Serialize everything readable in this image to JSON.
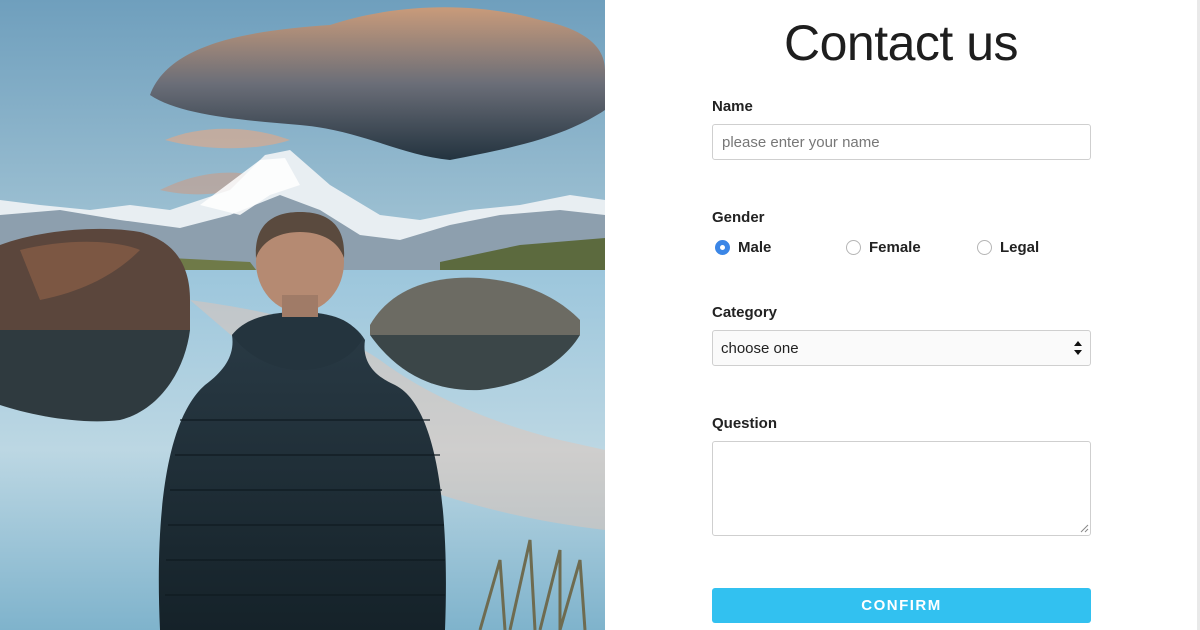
{
  "hero": {
    "icon": "mountain-lake-photo"
  },
  "form": {
    "title": "Contact us",
    "name": {
      "label": "Name",
      "placeholder": "please enter your name",
      "value": ""
    },
    "gender": {
      "label": "Gender",
      "options": [
        "Male",
        "Female",
        "Legal"
      ],
      "selected": "Male"
    },
    "category": {
      "label": "Category",
      "value": "choose one"
    },
    "question": {
      "label": "Question",
      "value": ""
    },
    "confirm_label": "CONFIRM"
  },
  "colors": {
    "accent": "#32c1f0",
    "radio_checked": "#3b86e6"
  }
}
